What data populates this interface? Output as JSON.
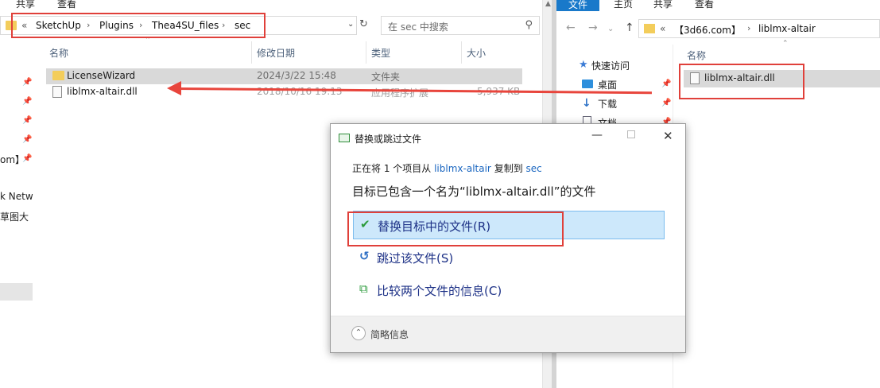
{
  "left": {
    "ribbon_tabs": [
      "共享",
      "查看"
    ],
    "breadcrumb_prefix": "«",
    "breadcrumbs": [
      "SketchUp",
      "Plugins",
      "Thea4SU_files",
      "sec"
    ],
    "search_placeholder": "在 sec 中搜索",
    "columns": [
      "名称",
      "修改日期",
      "类型",
      "大小"
    ],
    "files": [
      {
        "name": "LicenseWizard",
        "date": "2024/3/22 15:48",
        "type": "文件夹",
        "size": ""
      },
      {
        "name": "liblmx-altair.dll",
        "date": "2018/10/16 19:13",
        "type": "应用程序扩展",
        "size": "5,937 KB"
      }
    ],
    "nav_fragments": [
      "om】",
      "k Netw",
      "草图大"
    ]
  },
  "right": {
    "ribbon_tabs": [
      "文件",
      "主页",
      "共享",
      "查看"
    ],
    "breadcrumb_prefix": "«",
    "breadcrumbs": [
      "【3d66.com】",
      "liblmx-altair"
    ],
    "column": "名称",
    "nav": [
      "快速访问",
      "桌面",
      "下载",
      "文档"
    ],
    "files": [
      {
        "name": "liblmx-altair.dll"
      }
    ]
  },
  "dialog": {
    "title": "替换或跳过文件",
    "copy_prefix": "正在将 1 个项目从",
    "copy_src": "liblmx-altair",
    "copy_mid": "复制到",
    "copy_dst": "sec",
    "heading": "目标已包含一个名为“liblmx-altair.dll”的文件",
    "options": [
      {
        "label": "替换目标中的文件(R)"
      },
      {
        "label": "跳过该文件(S)"
      },
      {
        "label": "比较两个文件的信息(C)"
      }
    ],
    "details_label": "简略信息"
  },
  "colors": {
    "accent": "#1979ca",
    "annotation_red": "#e0403a",
    "selected_option": "#cde8fb"
  }
}
